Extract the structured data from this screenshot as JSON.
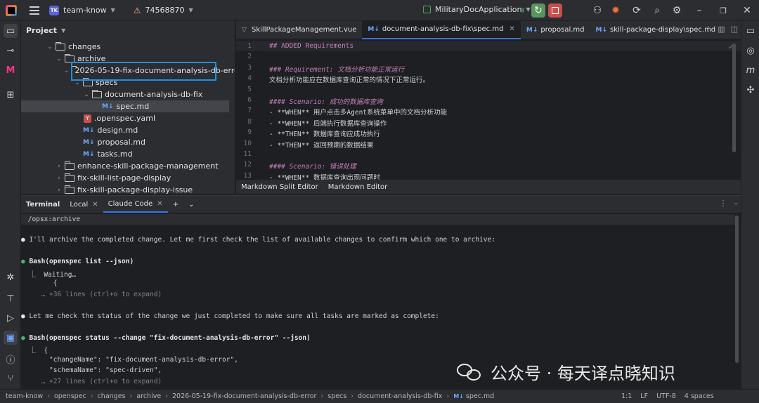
{
  "titlebar": {
    "project_badge": "TK",
    "project_name": "team-know",
    "warning_count": "74568870",
    "run_config": "MilitaryDocApplication"
  },
  "project_panel": {
    "title": "Project",
    "tree": [
      {
        "label": "changes",
        "type": "folder",
        "expanded": true
      },
      {
        "label": "archive",
        "type": "folder",
        "expanded": true
      },
      {
        "label": "2026-05-19-fix-document-analysis-db-error",
        "type": "folder",
        "expanded": true
      },
      {
        "label": "specs",
        "type": "folder",
        "expanded": true
      },
      {
        "label": "document-analysis-db-fix",
        "type": "folder",
        "expanded": true
      },
      {
        "label": "spec.md",
        "type": "md",
        "selected": true
      },
      {
        "label": ".openspec.yaml",
        "type": "yaml"
      },
      {
        "label": "design.md",
        "type": "md"
      },
      {
        "label": "proposal.md",
        "type": "md"
      },
      {
        "label": "tasks.md",
        "type": "md"
      },
      {
        "label": "enhance-skill-package-management",
        "type": "folder",
        "expanded": false
      },
      {
        "label": "fix-skill-list-page-display",
        "type": "folder",
        "expanded": false
      },
      {
        "label": "fix-skill-package-display-issue",
        "type": "folder",
        "expanded": false
      }
    ]
  },
  "editor": {
    "tabs": [
      {
        "label": "SkillPackageManagement.vue",
        "kind": "vue"
      },
      {
        "label": "document-analysis-db-fix\\spec.md",
        "kind": "md",
        "active": true
      },
      {
        "label": "proposal.md",
        "kind": "md"
      },
      {
        "label": "skill-package-display\\spec.md",
        "kind": "md"
      }
    ],
    "lines": [
      {
        "n": "1",
        "text": "## ADDED Requirements",
        "style": "h"
      },
      {
        "n": "2",
        "text": "",
        "style": "t"
      },
      {
        "n": "3",
        "text": "### Requirement: 文档分析功能正常运行",
        "style": "hi"
      },
      {
        "n": "4",
        "text": "文档分析功能应在数据库查询正常的情况下正常运行。",
        "style": "t"
      },
      {
        "n": "5",
        "text": "",
        "style": "t"
      },
      {
        "n": "6",
        "text": "#### Scenario: 成功的数据库查询",
        "style": "hi"
      },
      {
        "n": "7",
        "text": "- **WHEN** 用户点击多Agent系统菜单中的文档分析功能",
        "style": "b"
      },
      {
        "n": "8",
        "text": "- **WHEN** 后端执行数据库查询操作",
        "style": "b"
      },
      {
        "n": "9",
        "text": "- **THEN** 数据库查询应成功执行",
        "style": "b"
      },
      {
        "n": "10",
        "text": "- **THEN** 返回预期的数据结果",
        "style": "b"
      },
      {
        "n": "11",
        "text": "",
        "style": "t"
      },
      {
        "n": "12",
        "text": "#### Scenario: 错误处理",
        "style": "hi"
      },
      {
        "n": "13",
        "text": "- **WHEN** 数据库查询出现问题时",
        "style": "b"
      }
    ],
    "bottom_tabs": [
      "Markdown Split Editor",
      "Markdown Editor"
    ]
  },
  "terminal": {
    "title": "Terminal",
    "tabs": [
      "Local",
      "Claude Code"
    ],
    "lines": [
      {
        "text": " /opsx:archive",
        "kind": "cmd"
      },
      {
        "text": "",
        "kind": "blank"
      },
      {
        "text": "I'll archive the completed change. Let me first check the list of available changes to confirm which one to archive:",
        "kind": "dotw"
      },
      {
        "text": "",
        "kind": "blank"
      },
      {
        "text": "Bash(openspec list --json)",
        "kind": "dotg"
      },
      {
        "text": "  ⎿  Waiting…",
        "kind": "plain"
      },
      {
        "text": "        {",
        "kind": "plain"
      },
      {
        "text": "     … +36 lines (ctrl+o to expand)",
        "kind": "dim"
      },
      {
        "text": "",
        "kind": "blank"
      },
      {
        "text": "Let me check the status of the change we just completed to make sure all tasks are marked as complete:",
        "kind": "dotw"
      },
      {
        "text": "",
        "kind": "blank"
      },
      {
        "text": "Bash(openspec status --change \"fix-document-analysis-db-error\" --json)",
        "kind": "dotg"
      },
      {
        "text": "  ⎿  {",
        "kind": "plain"
      },
      {
        "text": "       \"changeName\": \"fix-document-analysis-db-error\",",
        "kind": "plain"
      },
      {
        "text": "       \"schemaName\": \"spec-driven\",",
        "kind": "plain"
      },
      {
        "text": "     … +27 lines (ctrl+o to expand)",
        "kind": "dim"
      }
    ]
  },
  "statusbar": {
    "breadcrumb": [
      "team-know",
      "openspec",
      "changes",
      "archive",
      "2026-05-19-fix-document-analysis-db-error",
      "specs",
      "document-analysis-db-fix",
      "spec.md"
    ],
    "position": "1:1",
    "line_sep": "LF",
    "encoding": "UTF-8",
    "indent": "4 spaces"
  },
  "watermark": {
    "text": "公众号 · 每天译点晓知识"
  },
  "colors": {
    "accent": "#3574f0",
    "highlight_box": "#1e90e5",
    "run_green": "#57965c",
    "stop_red": "#c94f4f"
  }
}
